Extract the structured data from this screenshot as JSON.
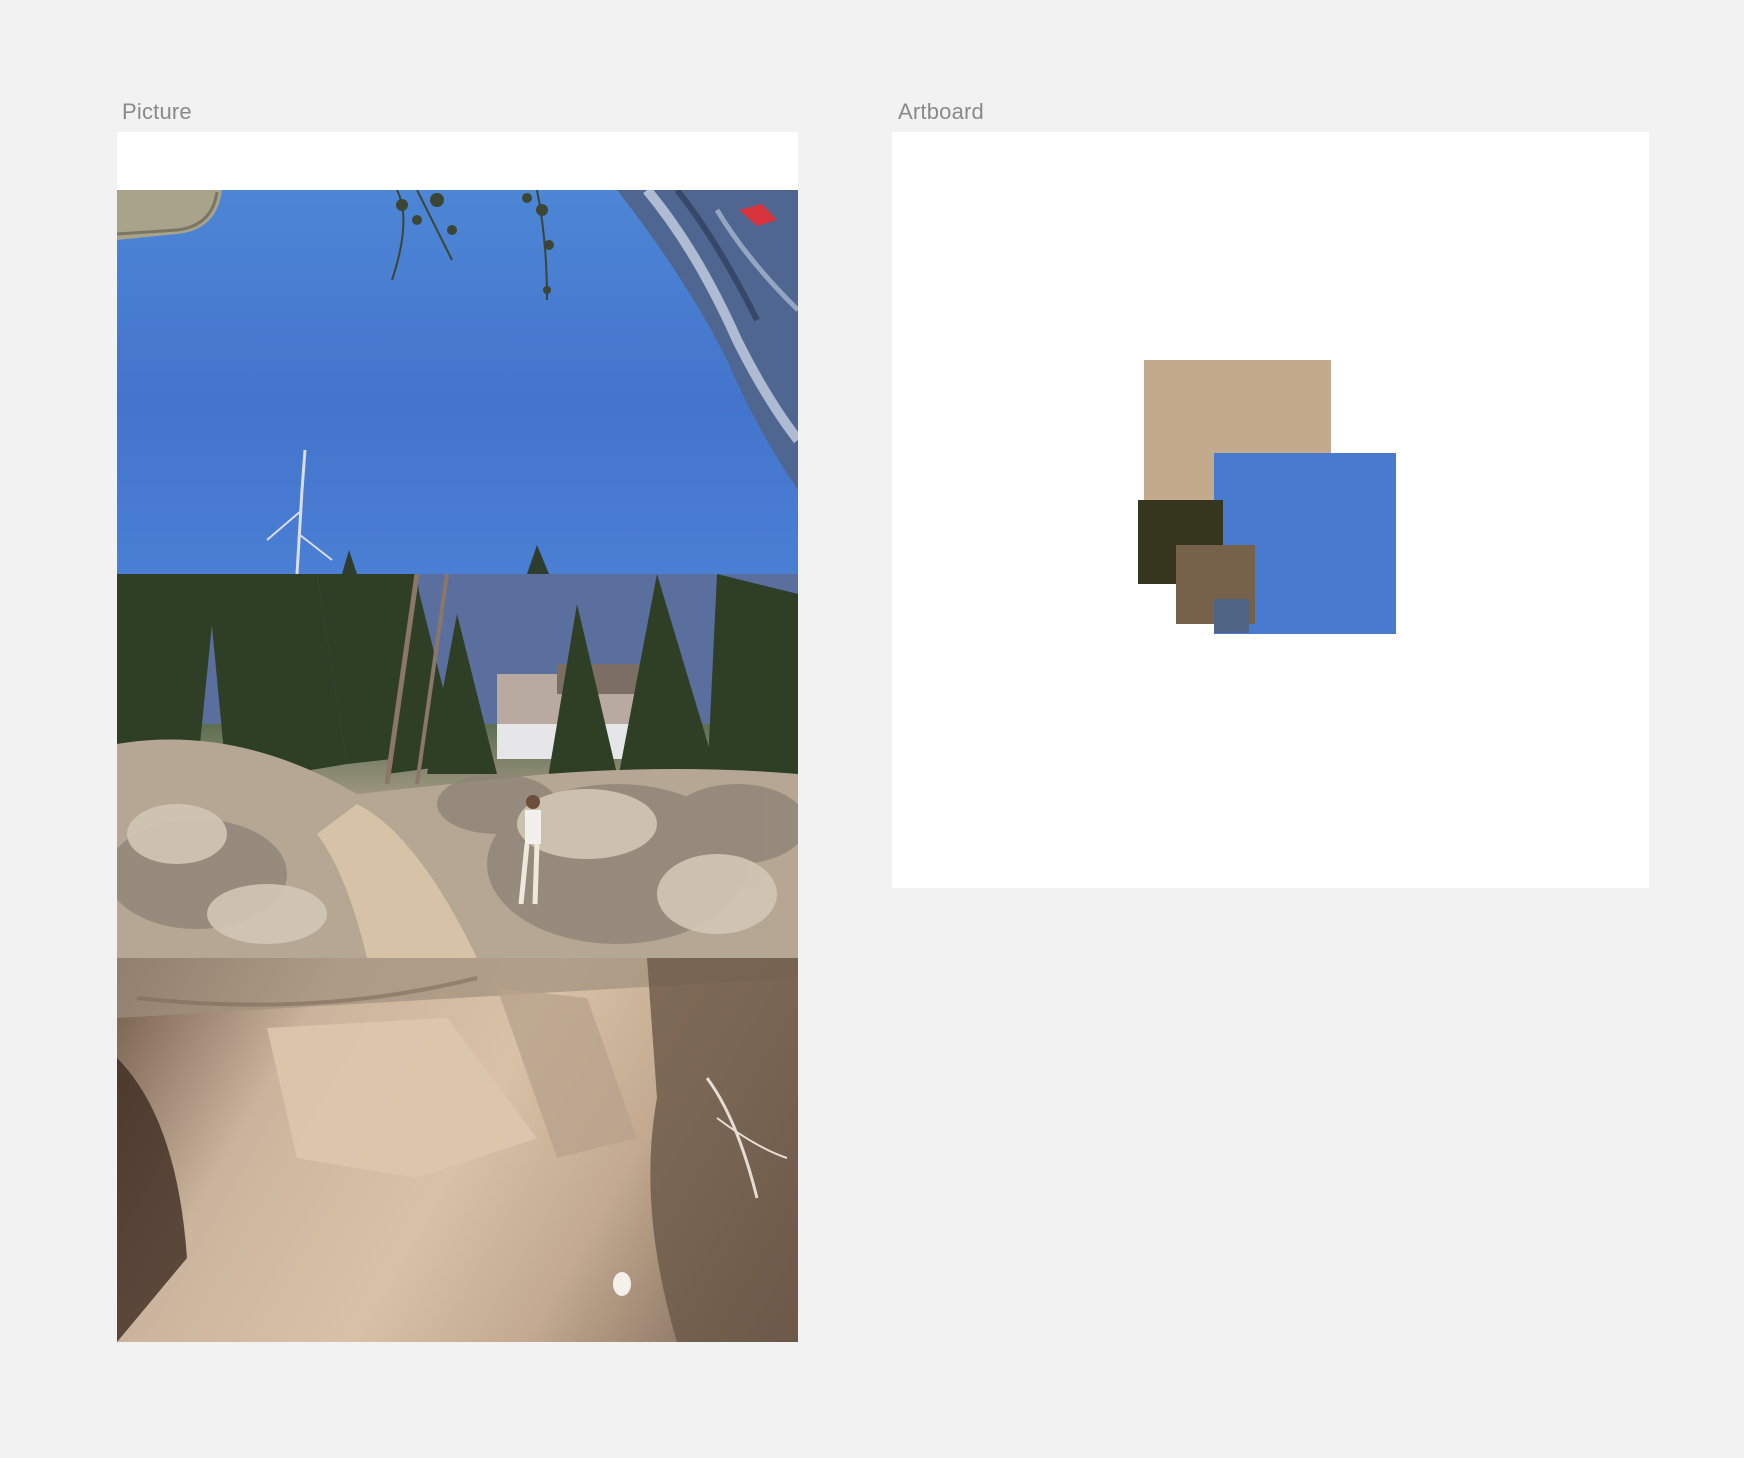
{
  "frames": {
    "picture": {
      "label": "Picture"
    },
    "artboard": {
      "label": "Artboard"
    }
  },
  "palette": {
    "beige": "#c3aa8d",
    "blue": "#487bcf",
    "dark_olive": "#36361f",
    "brown": "#76614b",
    "slate": "#4e6585"
  }
}
